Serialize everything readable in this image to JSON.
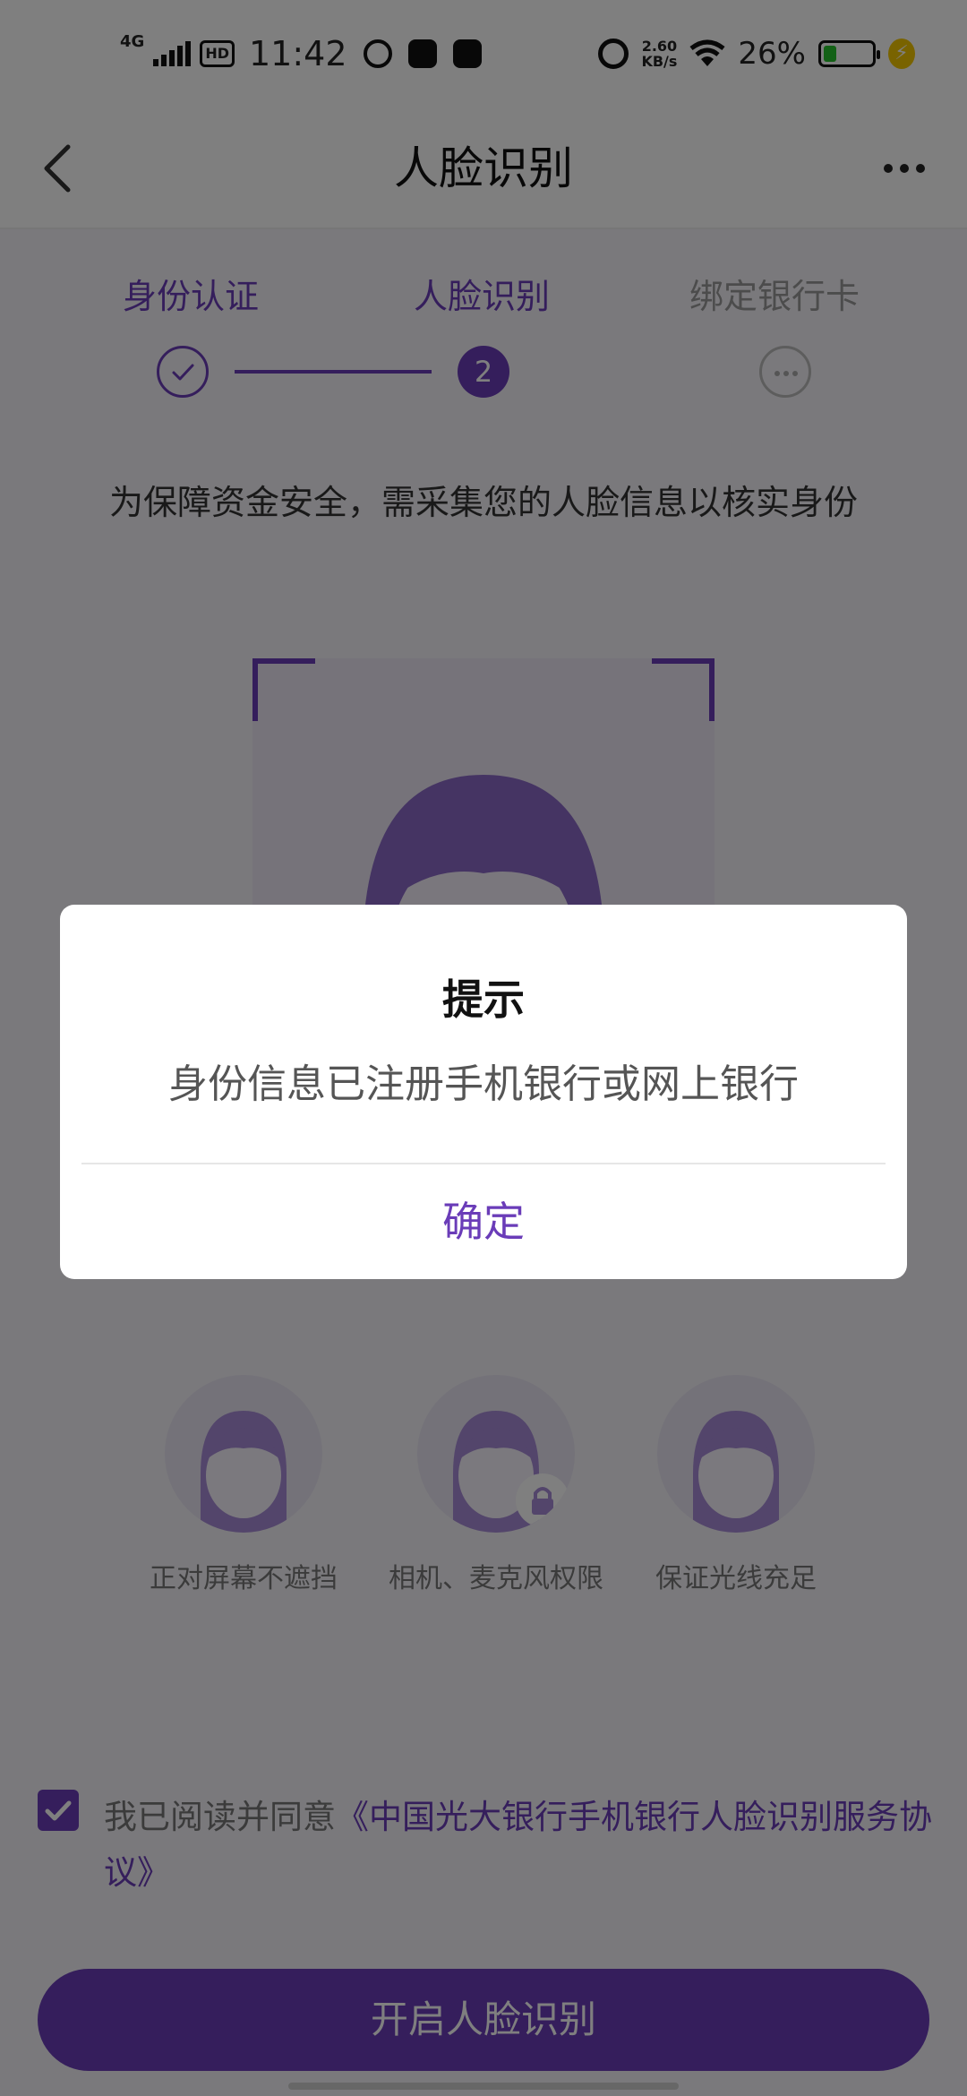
{
  "status_bar": {
    "network": "4G",
    "hd": "HD",
    "time": "11:42",
    "speed_value": "2.60",
    "speed_unit": "KB/s",
    "battery_percent": "26%",
    "battery_level": 0.26
  },
  "header": {
    "title": "人脸识别"
  },
  "steps": [
    {
      "label": "身份认证",
      "state": "done"
    },
    {
      "label": "人脸识别",
      "state": "current",
      "number": "2"
    },
    {
      "label": "绑定银行卡",
      "state": "pending"
    }
  ],
  "instruction": "为保障资金安全，需采集您的人脸信息以核实身份",
  "tips": [
    {
      "label": "正对屏幕不遮挡"
    },
    {
      "label": "相机、麦克风权限"
    },
    {
      "label": "保证光线充足"
    }
  ],
  "agreement": {
    "checked": true,
    "prefix": "我已阅读并同意",
    "link_text": "《中国光大银行手机银行人脸识别服务协议》"
  },
  "start_button": "开启人脸识别",
  "dialog": {
    "title": "提示",
    "message": "身份信息已注册手机银行或网上银行",
    "confirm": "确定"
  },
  "colors": {
    "accent": "#6a3cb8",
    "overlay": "rgba(0,0,0,0.5)"
  }
}
